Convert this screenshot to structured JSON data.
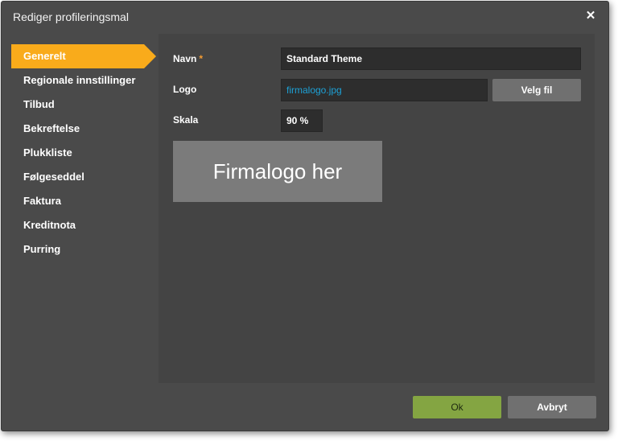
{
  "dialog": {
    "title": "Rediger profileringsmal",
    "close_glyph": "✕"
  },
  "sidebar": {
    "items": [
      {
        "label": "Generelt",
        "active": true
      },
      {
        "label": "Regionale innstillinger"
      },
      {
        "label": "Tilbud"
      },
      {
        "label": "Bekreftelse"
      },
      {
        "label": "Plukkliste"
      },
      {
        "label": "Følgeseddel"
      },
      {
        "label": "Faktura"
      },
      {
        "label": "Kreditnota"
      },
      {
        "label": "Purring"
      }
    ]
  },
  "form": {
    "name_label": "Navn",
    "required_marker": "*",
    "name_value": "Standard Theme",
    "logo_label": "Logo",
    "logo_file": "firmalogo.jpg",
    "choose_file_label": "Velg fil",
    "scale_label": "Skala",
    "scale_value": "90 %",
    "logo_preview_text": "Firmalogo her"
  },
  "footer": {
    "ok_label": "Ok",
    "cancel_label": "Avbryt"
  },
  "colors": {
    "accent": "#f9ab1b",
    "ok_button": "#84a542",
    "required_marker": "#f39c33",
    "link": "#1da1d6"
  }
}
